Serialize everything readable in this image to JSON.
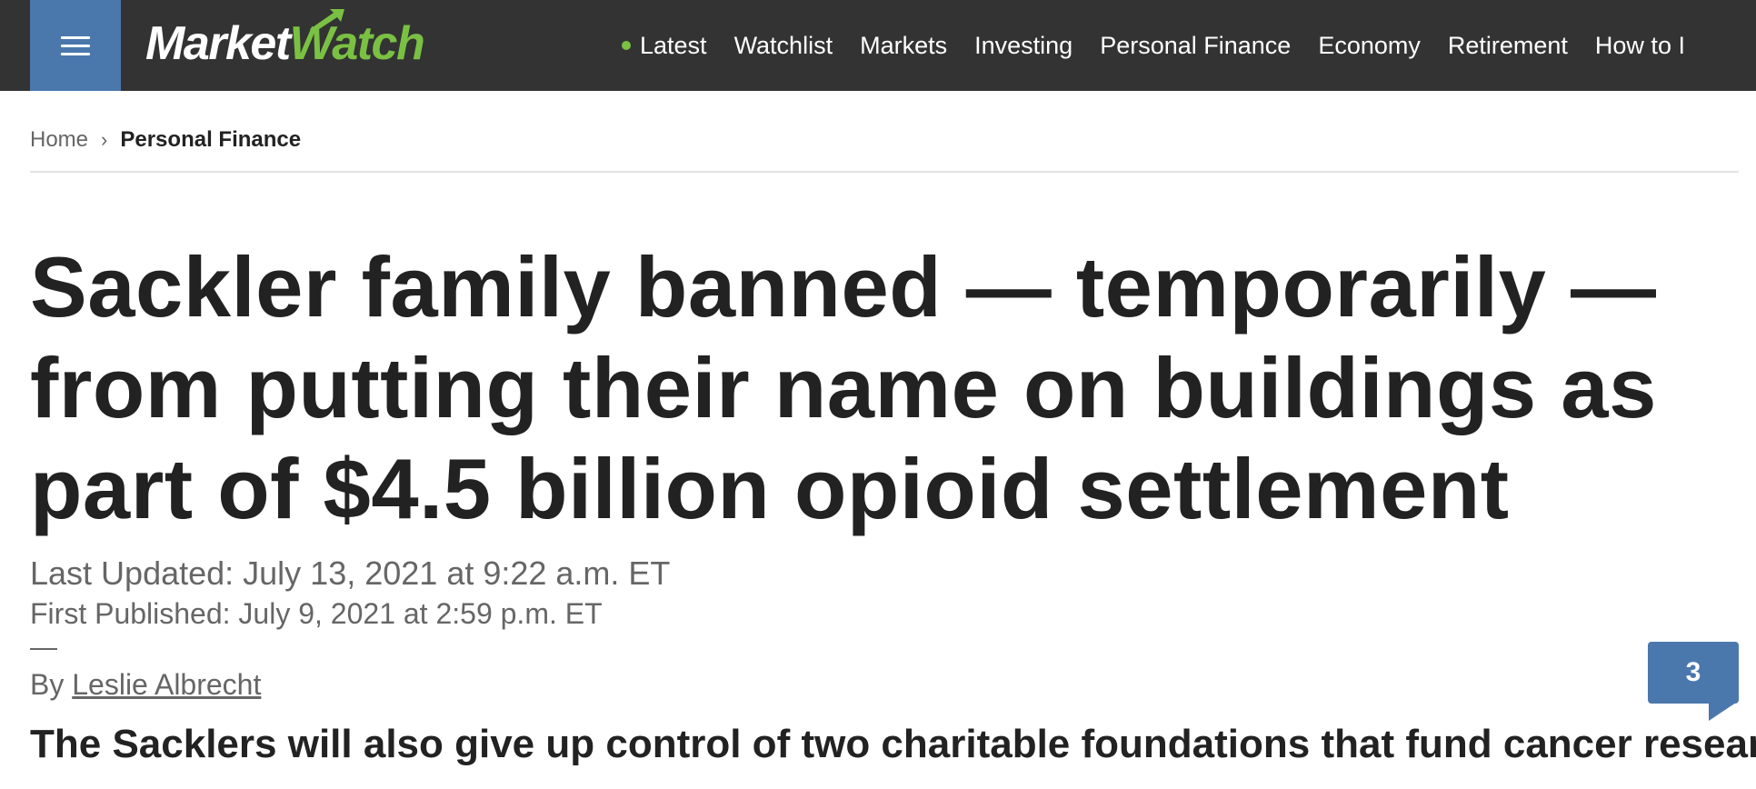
{
  "header": {
    "menu_icon": "hamburger-menu-icon",
    "logo": {
      "part1": "Market",
      "part2": "Watch"
    },
    "nav": [
      "Latest",
      "Watchlist",
      "Markets",
      "Investing",
      "Personal Finance",
      "Economy",
      "Retirement",
      "How to I"
    ],
    "live_dot_color": "#7ac143",
    "bar_color": "#333333",
    "menu_color": "#4a78ad"
  },
  "breadcrumb": {
    "home": "Home",
    "separator_icon": "chevron-right-icon",
    "separator": "›",
    "current": "Personal Finance"
  },
  "article": {
    "headline": "Sackler family banned — temporarily — from putting their name on buildings as part of $4.5 billion opioid settlement",
    "last_updated": "Last Updated: July 13, 2021 at 9:22 a.m. ET",
    "first_published": "First Published: July 9, 2021 at 2:59 p.m. ET",
    "rule": "—",
    "by": "By",
    "author": "Leslie Albrecht",
    "comment_count": "3",
    "dek": "The Sacklers will also give up control of two charitable foundations that fund cancer research."
  }
}
